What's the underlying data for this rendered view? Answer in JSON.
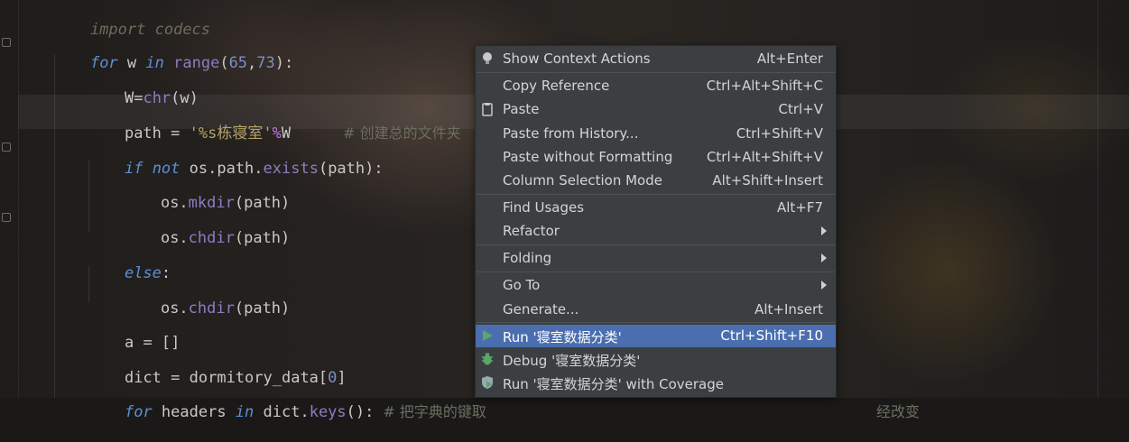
{
  "editor": {
    "lines": [
      {
        "kw1": "import",
        "t1": " codecs"
      },
      {
        "kw1": "for",
        "t1": " w ",
        "kw2": "in",
        "t2": " ",
        "fn": "range",
        "p1": "(",
        "n1": "65",
        "c": ",",
        "n2": "73",
        "p2": "):"
      },
      {
        "a": "W",
        "op": "=",
        "fn": "chr",
        "rest": "(w)"
      },
      {
        "a": "path",
        "op": " = ",
        "str": "'%s栋寝室'",
        "pct": "%",
        "b": "W",
        "cmt": "# 创建总的文件夹"
      },
      {
        "kw1": "if",
        "sp": " ",
        "kw2": "not",
        "t1": " os.path.",
        "fn": "exists",
        "rest": "(path):"
      },
      {
        "a": "os.",
        "fn": "mkdir",
        "rest": "(path)"
      },
      {
        "a": "os.",
        "fn": "chdir",
        "rest": "(path)"
      },
      {
        "kw1": "else",
        "rest": ":"
      },
      {
        "a": "os.",
        "fn": "chdir",
        "rest": "(path)"
      },
      {
        "a": "a",
        "op": " = ",
        "rest": "[]"
      },
      {
        "a": "dict",
        "op": " = ",
        "rest": "dormitory_data[",
        "n1": "0",
        "p1": "]"
      },
      {
        "kw1": "for",
        "t1": " headers ",
        "kw2": "in",
        "t2": " dict.",
        "fn": "keys",
        "rest": "():",
        "cmt": "# 把字典的键取",
        "cmt2": "经改变"
      }
    ]
  },
  "menu": {
    "items": [
      {
        "label": "Show Context Actions",
        "shortcut": "Alt+Enter",
        "icon": "lightbulb-icon"
      },
      {
        "label": "Copy Reference",
        "shortcut": "Ctrl+Alt+Shift+C"
      },
      {
        "label": "Paste",
        "shortcut": "Ctrl+V",
        "icon": "clipboard-icon"
      },
      {
        "label": "Paste from History...",
        "shortcut": "Ctrl+Shift+V"
      },
      {
        "label": "Paste without Formatting",
        "shortcut": "Ctrl+Alt+Shift+V"
      },
      {
        "label": "Column Selection Mode",
        "shortcut": "Alt+Shift+Insert"
      },
      {
        "label": "Find Usages",
        "shortcut": "Alt+F7"
      },
      {
        "label": "Refactor",
        "shortcut": ""
      },
      {
        "label": "Folding",
        "shortcut": ""
      },
      {
        "label": "Go To",
        "shortcut": ""
      },
      {
        "label": "Generate...",
        "shortcut": "Alt+Insert"
      },
      {
        "label": "Run '寝室数据分类'",
        "shortcut": "Ctrl+Shift+F10",
        "icon": "run-icon"
      },
      {
        "label": "Debug '寝室数据分类'",
        "shortcut": "",
        "icon": "debug-icon"
      },
      {
        "label": "Run '寝室数据分类' with Coverage",
        "shortcut": "",
        "icon": "coverage-icon"
      }
    ]
  },
  "colors": {
    "menu_bg": "#3c3f41",
    "selection": "#4b6eaf",
    "keyword": "#5c8fd6",
    "string": "#b5a36a"
  }
}
